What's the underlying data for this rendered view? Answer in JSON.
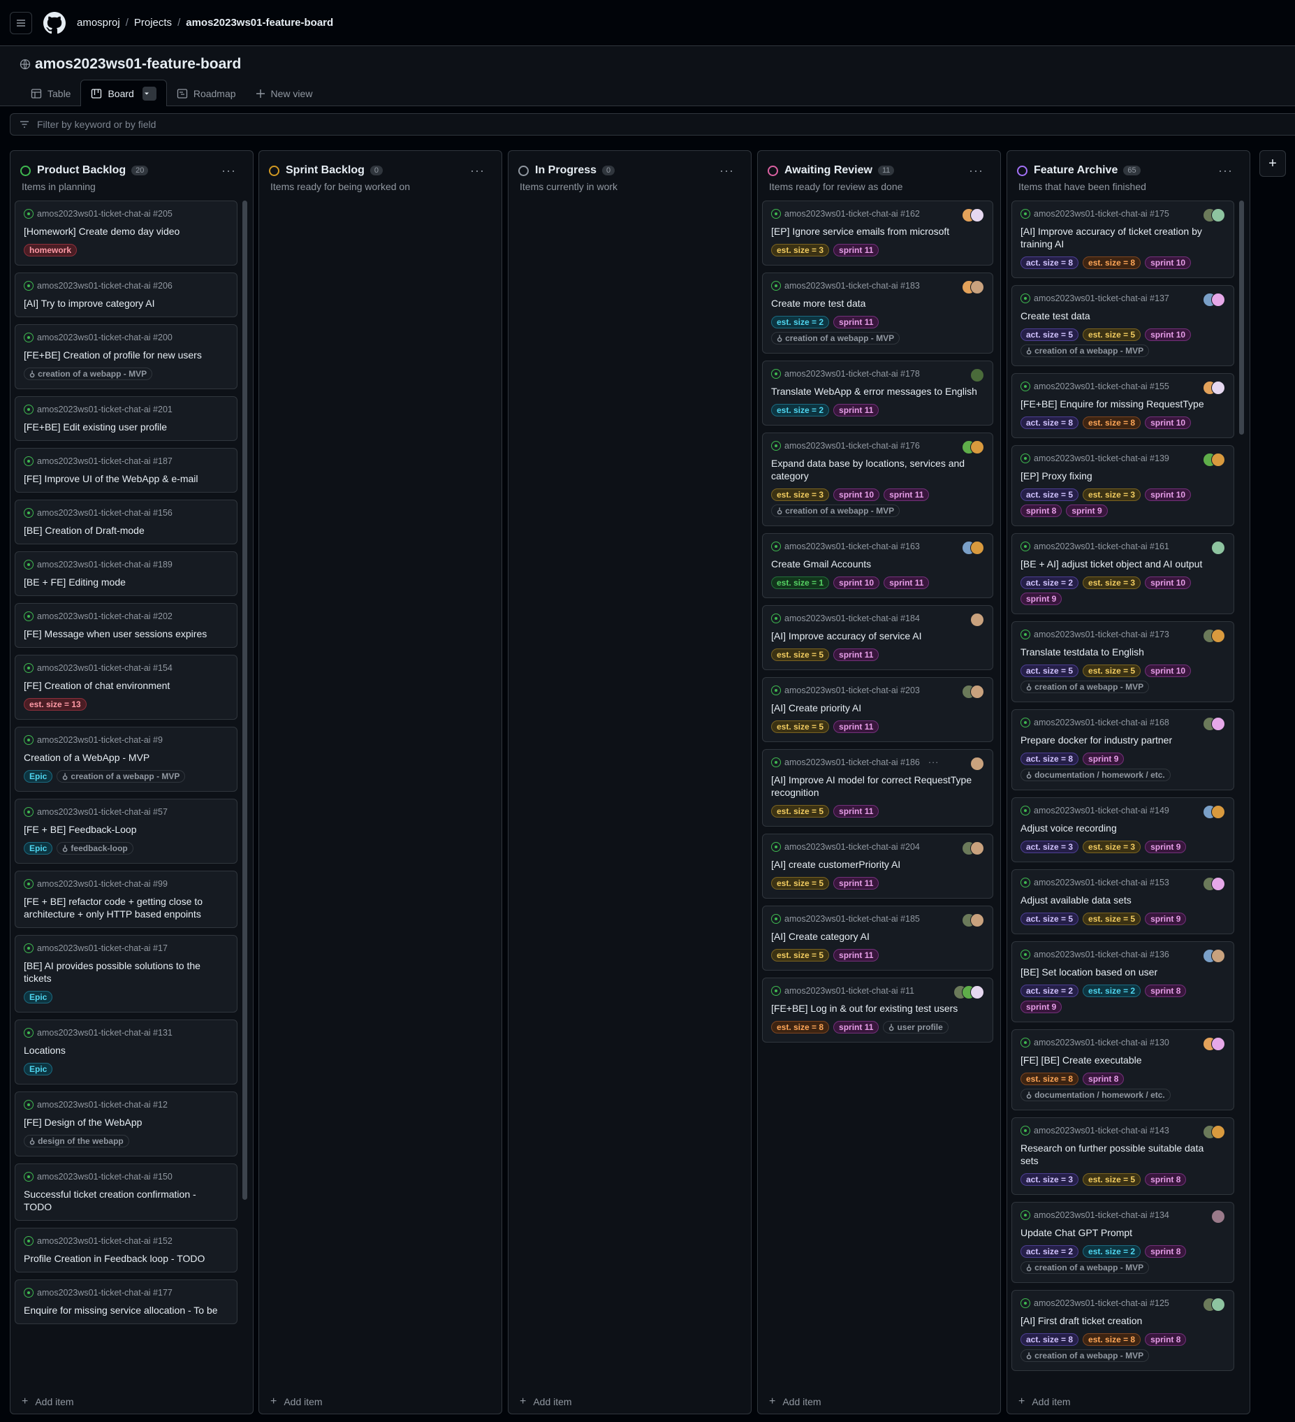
{
  "breadcrumbs": {
    "owner": "amosproj",
    "projects": "Projects",
    "board": "amos2023ws01-feature-board"
  },
  "project": {
    "title": "amos2023ws01-feature-board"
  },
  "tabs": {
    "table": "Table",
    "board": "Board",
    "roadmap": "Roadmap",
    "new_view": "New view"
  },
  "filter": {
    "placeholder": "Filter by keyword or by field"
  },
  "add_item": "Add item",
  "columns": [
    {
      "title": "Product Backlog",
      "count": "20",
      "desc": "Items in planning",
      "color": "#3fb950",
      "scroll": true,
      "cards": [
        {
          "repo": "amos2023ws01-ticket-chat-ai #205",
          "title": "[Homework] Create demo day video",
          "labels": [
            {
              "t": "homework",
              "c": "red"
            }
          ]
        },
        {
          "repo": "amos2023ws01-ticket-chat-ai #206",
          "title": "[AI] Try to improve category AI",
          "labels": []
        },
        {
          "repo": "amos2023ws01-ticket-chat-ai #200",
          "title": "[FE+BE] Creation of profile for new users",
          "labels": [
            {
              "t": "creation of a webapp - MVP",
              "c": "ms"
            }
          ]
        },
        {
          "repo": "amos2023ws01-ticket-chat-ai #201",
          "title": "[FE+BE] Edit existing user profile",
          "labels": []
        },
        {
          "repo": "amos2023ws01-ticket-chat-ai #187",
          "title": "[FE] Improve UI of the WebApp & e-mail",
          "labels": []
        },
        {
          "repo": "amos2023ws01-ticket-chat-ai #156",
          "title": "[BE] Creation of Draft-mode",
          "labels": []
        },
        {
          "repo": "amos2023ws01-ticket-chat-ai #189",
          "title": "[BE + FE] Editing mode",
          "labels": []
        },
        {
          "repo": "amos2023ws01-ticket-chat-ai #202",
          "title": "[FE] Message when user sessions expires",
          "labels": []
        },
        {
          "repo": "amos2023ws01-ticket-chat-ai #154",
          "title": "[FE] Creation of chat environment",
          "labels": [
            {
              "t": "est. size = 13",
              "c": "red"
            }
          ]
        },
        {
          "repo": "amos2023ws01-ticket-chat-ai #9",
          "title": "Creation of a WebApp - MVP",
          "labels": [
            {
              "t": "Epic",
              "c": "cyan"
            },
            {
              "t": "creation of a webapp - MVP",
              "c": "ms"
            }
          ]
        },
        {
          "repo": "amos2023ws01-ticket-chat-ai #57",
          "title": "[FE + BE] Feedback-Loop",
          "labels": [
            {
              "t": "Epic",
              "c": "cyan"
            },
            {
              "t": "feedback-loop",
              "c": "ms"
            }
          ]
        },
        {
          "repo": "amos2023ws01-ticket-chat-ai #99",
          "title": "[FE + BE] refactor code + getting close to architecture + only HTTP based enpoints",
          "labels": []
        },
        {
          "repo": "amos2023ws01-ticket-chat-ai #17",
          "title": "[BE] AI provides possible solutions to the tickets",
          "labels": [
            {
              "t": "Epic",
              "c": "cyan"
            }
          ]
        },
        {
          "repo": "amos2023ws01-ticket-chat-ai #131",
          "title": "Locations",
          "labels": [
            {
              "t": "Epic",
              "c": "cyan"
            }
          ]
        },
        {
          "repo": "amos2023ws01-ticket-chat-ai #12",
          "title": "[FE] Design of the WebApp",
          "labels": [
            {
              "t": "design of the webapp",
              "c": "ms"
            }
          ]
        },
        {
          "repo": "amos2023ws01-ticket-chat-ai #150",
          "title": "Successful ticket creation confirmation - TODO",
          "labels": []
        },
        {
          "repo": "amos2023ws01-ticket-chat-ai #152",
          "title": "Profile Creation in Feedback loop - TODO",
          "labels": []
        },
        {
          "repo": "amos2023ws01-ticket-chat-ai #177",
          "title": "Enquire for missing service allocation - To be",
          "labels": []
        }
      ]
    },
    {
      "title": "Sprint Backlog",
      "count": "0",
      "desc": "Items ready for being worked on",
      "color": "#d29922",
      "scroll": false,
      "cards": []
    },
    {
      "title": "In Progress",
      "count": "0",
      "desc": "Items currently in work",
      "color": "#9198a1",
      "scroll": false,
      "cards": []
    },
    {
      "title": "Awaiting Review",
      "count": "11",
      "desc": "Items ready for review as done",
      "color": "#db61a2",
      "scroll": false,
      "cards": [
        {
          "repo": "amos2023ws01-ticket-chat-ai #162",
          "title": "[EP] Ignore service emails from microsoft",
          "labels": [
            {
              "t": "est. size = 3",
              "c": "yellow"
            },
            {
              "t": "sprint 11",
              "c": "pink"
            }
          ],
          "avs": [
            "#e3a25a",
            "#e6d8f0"
          ]
        },
        {
          "repo": "amos2023ws01-ticket-chat-ai #183",
          "title": "Create more test data",
          "labels": [
            {
              "t": "est. size = 2",
              "c": "cyan"
            },
            {
              "t": "sprint 11",
              "c": "pink"
            },
            {
              "t": "creation of a webapp - MVP",
              "c": "ms"
            }
          ],
          "avs": [
            "#e3a25a",
            "#c9a27e"
          ]
        },
        {
          "repo": "amos2023ws01-ticket-chat-ai #178",
          "title": "Translate WebApp & error messages to English",
          "labels": [
            {
              "t": "est. size = 2",
              "c": "cyan"
            },
            {
              "t": "sprint 11",
              "c": "pink"
            }
          ],
          "avs": [
            "#4a6b3a"
          ]
        },
        {
          "repo": "amos2023ws01-ticket-chat-ai #176",
          "title": "Expand data base by locations, services and category",
          "labels": [
            {
              "t": "est. size = 3",
              "c": "yellow"
            },
            {
              "t": "sprint 10",
              "c": "pink"
            },
            {
              "t": "sprint 11",
              "c": "pink"
            },
            {
              "t": "creation of a webapp - MVP",
              "c": "ms"
            }
          ],
          "avs": [
            "#5fae4a",
            "#d99a3e"
          ]
        },
        {
          "repo": "amos2023ws01-ticket-chat-ai #163",
          "title": "Create Gmail Accounts",
          "labels": [
            {
              "t": "est. size = 1",
              "c": "green"
            },
            {
              "t": "sprint 10",
              "c": "pink"
            },
            {
              "t": "sprint 11",
              "c": "pink"
            }
          ],
          "avs": [
            "#7aa0c8",
            "#d99a3e"
          ]
        },
        {
          "repo": "amos2023ws01-ticket-chat-ai #184",
          "title": "[AI] Improve accuracy of service AI",
          "labels": [
            {
              "t": "est. size = 5",
              "c": "yellow"
            },
            {
              "t": "sprint 11",
              "c": "pink"
            }
          ],
          "avs": [
            "#c9a27e"
          ]
        },
        {
          "repo": "amos2023ws01-ticket-chat-ai #203",
          "title": "[AI] Create priority AI",
          "labels": [
            {
              "t": "est. size = 5",
              "c": "yellow"
            },
            {
              "t": "sprint 11",
              "c": "pink"
            }
          ],
          "avs": [
            "#6b7a5a",
            "#c9a27e"
          ]
        },
        {
          "repo": "amos2023ws01-ticket-chat-ai #186",
          "title": "[AI] Improve AI model for correct RequestType recognition",
          "labels": [
            {
              "t": "est. size = 5",
              "c": "yellow"
            },
            {
              "t": "sprint 11",
              "c": "pink"
            }
          ],
          "avs": [
            "#c9a27e"
          ],
          "more": true
        },
        {
          "repo": "amos2023ws01-ticket-chat-ai #204",
          "title": "[AI] create customerPriority AI",
          "labels": [
            {
              "t": "est. size = 5",
              "c": "yellow"
            },
            {
              "t": "sprint 11",
              "c": "pink"
            }
          ],
          "avs": [
            "#6b7a5a",
            "#c9a27e"
          ]
        },
        {
          "repo": "amos2023ws01-ticket-chat-ai #185",
          "title": "[AI] Create category AI",
          "labels": [
            {
              "t": "est. size = 5",
              "c": "yellow"
            },
            {
              "t": "sprint 11",
              "c": "pink"
            }
          ],
          "avs": [
            "#6b7a5a",
            "#c9a27e"
          ]
        },
        {
          "repo": "amos2023ws01-ticket-chat-ai #11",
          "title": "[FE+BE] Log in & out for existing test users",
          "labels": [
            {
              "t": "est. size = 8",
              "c": "orange"
            },
            {
              "t": "sprint 11",
              "c": "pink"
            },
            {
              "t": "user profile",
              "c": "ms"
            }
          ],
          "avs": [
            "#6b7a5a",
            "#5fae4a",
            "#e6d8f0"
          ]
        }
      ]
    },
    {
      "title": "Feature Archive",
      "count": "65",
      "desc": "Items that have been finished",
      "color": "#a371f7",
      "scroll": true,
      "cards": [
        {
          "repo": "amos2023ws01-ticket-chat-ai #175",
          "title": "[AI] Improve accuracy of ticket creation by training AI",
          "labels": [
            {
              "t": "act. size = 8",
              "c": "purple"
            },
            {
              "t": "est. size = 8",
              "c": "orange"
            },
            {
              "t": "sprint 10",
              "c": "pink"
            }
          ],
          "avs": [
            "#6b7a5a",
            "#8ec4a0"
          ]
        },
        {
          "repo": "amos2023ws01-ticket-chat-ai #137",
          "title": "Create test data",
          "labels": [
            {
              "t": "act. size = 5",
              "c": "purple"
            },
            {
              "t": "est. size = 5",
              "c": "yellow"
            },
            {
              "t": "sprint 10",
              "c": "pink"
            },
            {
              "t": "creation of a webapp - MVP",
              "c": "ms"
            }
          ],
          "avs": [
            "#7aa0c8",
            "#e6a8e8"
          ]
        },
        {
          "repo": "amos2023ws01-ticket-chat-ai #155",
          "title": "[FE+BE] Enquire for missing RequestType",
          "labels": [
            {
              "t": "act. size = 8",
              "c": "purple"
            },
            {
              "t": "est. size = 8",
              "c": "orange"
            },
            {
              "t": "sprint 10",
              "c": "pink"
            }
          ],
          "avs": [
            "#e3a25a",
            "#e6d8f0"
          ]
        },
        {
          "repo": "amos2023ws01-ticket-chat-ai #139",
          "title": "[EP] Proxy fixing",
          "labels": [
            {
              "t": "act. size = 5",
              "c": "purple"
            },
            {
              "t": "est. size = 3",
              "c": "yellow"
            },
            {
              "t": "sprint 10",
              "c": "pink"
            },
            {
              "t": "sprint 8",
              "c": "pink"
            },
            {
              "t": "sprint 9",
              "c": "pink"
            }
          ],
          "avs": [
            "#5fae4a",
            "#d99a3e"
          ]
        },
        {
          "repo": "amos2023ws01-ticket-chat-ai #161",
          "title": "[BE + AI] adjust ticket object and AI output",
          "labels": [
            {
              "t": "act. size = 2",
              "c": "purple"
            },
            {
              "t": "est. size = 3",
              "c": "yellow"
            },
            {
              "t": "sprint 10",
              "c": "pink"
            },
            {
              "t": "sprint 9",
              "c": "pink"
            }
          ],
          "avs": [
            "#8ec4a0"
          ]
        },
        {
          "repo": "amos2023ws01-ticket-chat-ai #173",
          "title": "Translate testdata to English",
          "labels": [
            {
              "t": "act. size = 5",
              "c": "purple"
            },
            {
              "t": "est. size = 5",
              "c": "yellow"
            },
            {
              "t": "sprint 10",
              "c": "pink"
            },
            {
              "t": "creation of a webapp - MVP",
              "c": "ms"
            }
          ],
          "avs": [
            "#6b7a5a",
            "#d99a3e"
          ]
        },
        {
          "repo": "amos2023ws01-ticket-chat-ai #168",
          "title": "Prepare docker for industry partner",
          "labels": [
            {
              "t": "act. size = 8",
              "c": "purple"
            },
            {
              "t": "sprint 9",
              "c": "pink"
            },
            {
              "t": "documentation / homework / etc.",
              "c": "ms"
            }
          ],
          "avs": [
            "#6b7a5a",
            "#e6a8e8"
          ]
        },
        {
          "repo": "amos2023ws01-ticket-chat-ai #149",
          "title": "Adjust voice recording",
          "labels": [
            {
              "t": "act. size = 3",
              "c": "purple"
            },
            {
              "t": "est. size = 3",
              "c": "yellow"
            },
            {
              "t": "sprint 9",
              "c": "pink"
            }
          ],
          "avs": [
            "#7aa0c8",
            "#d99a3e"
          ]
        },
        {
          "repo": "amos2023ws01-ticket-chat-ai #153",
          "title": "Adjust available data sets",
          "labels": [
            {
              "t": "act. size = 5",
              "c": "purple"
            },
            {
              "t": "est. size = 5",
              "c": "yellow"
            },
            {
              "t": "sprint 9",
              "c": "pink"
            }
          ],
          "avs": [
            "#6b7a5a",
            "#e6a8e8"
          ]
        },
        {
          "repo": "amos2023ws01-ticket-chat-ai #136",
          "title": "[BE] Set location based on user",
          "labels": [
            {
              "t": "act. size = 2",
              "c": "purple"
            },
            {
              "t": "est. size = 2",
              "c": "cyan"
            },
            {
              "t": "sprint 8",
              "c": "pink"
            },
            {
              "t": "sprint 9",
              "c": "pink"
            }
          ],
          "avs": [
            "#7aa0c8",
            "#c9a27e"
          ]
        },
        {
          "repo": "amos2023ws01-ticket-chat-ai #130",
          "title": "[FE] [BE] Create executable",
          "labels": [
            {
              "t": "est. size = 8",
              "c": "orange"
            },
            {
              "t": "sprint 8",
              "c": "pink"
            },
            {
              "t": "documentation / homework / etc.",
              "c": "ms"
            }
          ],
          "avs": [
            "#e3a25a",
            "#e6a8e8"
          ]
        },
        {
          "repo": "amos2023ws01-ticket-chat-ai #143",
          "title": "Research on further possible suitable data sets",
          "labels": [
            {
              "t": "act. size = 3",
              "c": "purple"
            },
            {
              "t": "est. size = 5",
              "c": "yellow"
            },
            {
              "t": "sprint 8",
              "c": "pink"
            }
          ],
          "avs": [
            "#6b7a5a",
            "#d99a3e"
          ]
        },
        {
          "repo": "amos2023ws01-ticket-chat-ai #134",
          "title": "Update Chat GPT Prompt",
          "labels": [
            {
              "t": "act. size = 2",
              "c": "purple"
            },
            {
              "t": "est. size = 2",
              "c": "cyan"
            },
            {
              "t": "sprint 8",
              "c": "pink"
            },
            {
              "t": "creation of a webapp - MVP",
              "c": "ms"
            }
          ],
          "avs": [
            "#9a7a8a"
          ]
        },
        {
          "repo": "amos2023ws01-ticket-chat-ai #125",
          "title": "[AI] First draft ticket creation",
          "labels": [
            {
              "t": "act. size = 8",
              "c": "purple"
            },
            {
              "t": "est. size = 8",
              "c": "orange"
            },
            {
              "t": "sprint 8",
              "c": "pink"
            },
            {
              "t": "creation of a webapp - MVP",
              "c": "ms"
            }
          ],
          "avs": [
            "#6b7a5a",
            "#8ec4a0"
          ]
        }
      ]
    }
  ],
  "label_colors": {
    "red": {
      "fg": "#ff9aa6",
      "bg": "#4a1d24",
      "bd": "#8e2f3b"
    },
    "yellow": {
      "fg": "#f2cc60",
      "bg": "#3b3214",
      "bd": "#7a6320"
    },
    "cyan": {
      "fg": "#4fd6f0",
      "bg": "#0d3440",
      "bd": "#1b6a80"
    },
    "green": {
      "fg": "#56d364",
      "bg": "#12351c",
      "bd": "#23713a"
    },
    "orange": {
      "fg": "#ffa657",
      "bg": "#3d2412",
      "bd": "#7d4520"
    },
    "pink": {
      "fg": "#e79ee8",
      "bg": "#38163c",
      "bd": "#73307a"
    },
    "purple": {
      "fg": "#d2c4ff",
      "bg": "#251f48",
      "bd": "#4d3f92"
    }
  }
}
